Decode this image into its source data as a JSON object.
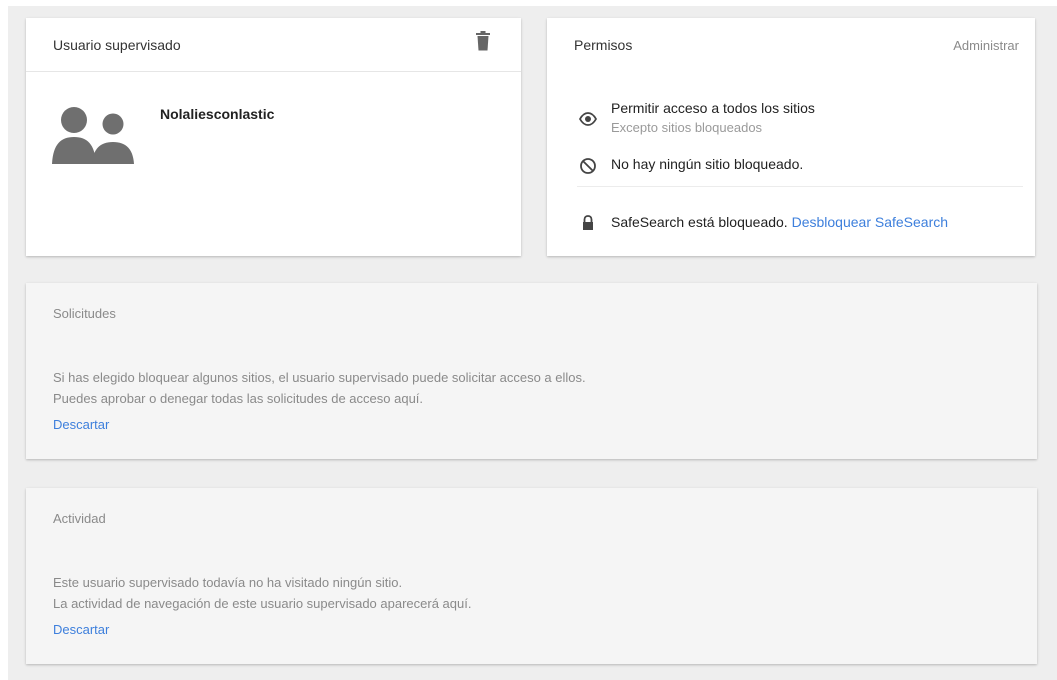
{
  "supervised_user": {
    "title": "Usuario supervisado",
    "name": "Nolaliesconlastic",
    "icons": {
      "delete": "trash-icon",
      "avatar": "supervised-user-avatar-icon"
    }
  },
  "permissions": {
    "title": "Permisos",
    "manage_label": "Administrar",
    "allow_all": {
      "icon": "eye-icon",
      "label": "Permitir acceso a todos los sitios",
      "sublabel": "Excepto sitios bloqueados"
    },
    "blocked": {
      "icon": "block-icon",
      "label": "No hay ningún sitio bloqueado."
    },
    "safesearch": {
      "icon": "lock-icon",
      "label": "SafeSearch está bloqueado.",
      "link": "Desbloquear SafeSearch"
    }
  },
  "requests": {
    "title": "Solicitudes",
    "line1": "Si has elegido bloquear algunos sitios, el usuario supervisado puede solicitar acceso a ellos.",
    "line2": "Puedes aprobar o denegar todas las solicitudes de acceso aquí.",
    "dismiss_label": "Descartar"
  },
  "activity": {
    "title": "Actividad",
    "line1": "Este usuario supervisado todavía no ha visitado ningún sitio.",
    "line2": "La actividad de navegación de este usuario supervisado aparecerá aquí.",
    "dismiss_label": "Descartar"
  },
  "colors": {
    "background": "#eeeeee",
    "card": "#ffffff",
    "card_muted": "#f5f5f5",
    "link": "#3d7fdc",
    "muted_text": "#8a8a8a",
    "icon": "#777777"
  }
}
